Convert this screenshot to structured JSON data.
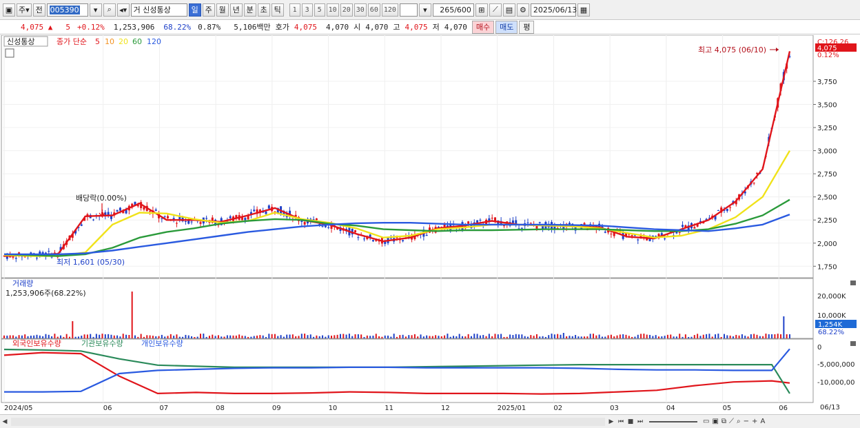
{
  "toolbar": {
    "market": "주",
    "prev_label": "전",
    "code": "005390",
    "type_prefix": "거",
    "stock_name": "신성통상",
    "periods": [
      "일",
      "주",
      "월",
      "년",
      "분",
      "초",
      "틱"
    ],
    "active_period": "일",
    "intervals": [
      "1",
      "3",
      "5",
      "10",
      "20",
      "30",
      "60",
      "120"
    ],
    "count": "265",
    "count_max": "/600",
    "date": "2025/06/13"
  },
  "quote": {
    "price": "4,075",
    "arrow": "▲",
    "change": "5",
    "change_pct": "+0.12%",
    "volume": "1,253,906",
    "volume_ratio": "68.22%",
    "turnover_pct": "0.87%",
    "amount": "5,106백만",
    "ask_label": "호가",
    "ask": "4,075",
    "bid": "4,070",
    "open_label": "시",
    "open": "4,070",
    "high_label": "고",
    "high": "4,075",
    "low_label": "저",
    "low": "4,070",
    "buy_label": "매수",
    "sell_label": "매도",
    "avg_label": "평"
  },
  "price_panel": {
    "tag": "신성통상",
    "legend_title": "종가 단순",
    "ma_labels": [
      "5",
      "10",
      "20",
      "60",
      "120"
    ],
    "ma_colors": [
      "#e0151b",
      "#f29222",
      "#f0e21a",
      "#2a9a3a",
      "#2a5ae0"
    ],
    "y_ticks": [
      "3,750",
      "3,500",
      "3,250",
      "3,000",
      "2,750",
      "2,500",
      "2,250",
      "2,000",
      "1,750"
    ],
    "y_top_label": "C:126.26",
    "current_tag": "4,075",
    "current_pct": "0.12%",
    "high_annotation": "최고 4,075 (06/10)",
    "low_annotation": "최저 1,601 (05/30)",
    "dividend_annotation": "배당락(0.00%)"
  },
  "volume_panel": {
    "title": "거래량",
    "value": "1,253,906주(68.22%)",
    "y_ticks": [
      "20,000K",
      "10,000K"
    ],
    "current_tag": "1,254K",
    "current_pct": "68.22%"
  },
  "holding_panel": {
    "legend": [
      {
        "label": "외국인보유수량",
        "color": "#e0151b"
      },
      {
        "label": "기관보유수량",
        "color": "#2a8a5a"
      },
      {
        "label": "개인보유수량",
        "color": "#2a5ae0"
      }
    ],
    "y_ticks": [
      "0",
      "-5,000,000",
      "-10,000,00"
    ]
  },
  "x_axis": {
    "labels": [
      "2024/05",
      "06",
      "07",
      "08",
      "09",
      "10",
      "11",
      "12",
      "2025/01",
      "02",
      "03",
      "04",
      "05",
      "06"
    ],
    "right_label": "06/13"
  },
  "chart_data": {
    "type": "line",
    "series": [
      {
        "name": "5",
        "color": "#e0151b",
        "values": [
          1860,
          1870,
          1885,
          2290,
          2300,
          2430,
          2250,
          2250,
          2230,
          2300,
          2380,
          2250,
          2200,
          2100,
          2020,
          2060,
          2160,
          2190,
          2240,
          2200,
          2190,
          2180,
          2170,
          2070,
          2050,
          2150,
          2250,
          2450,
          2800,
          4075
        ]
      },
      {
        "name": "20",
        "color": "#f0e21a",
        "values": [
          1870,
          1860,
          1860,
          1900,
          2200,
          2330,
          2320,
          2260,
          2220,
          2240,
          2330,
          2260,
          2220,
          2160,
          2060,
          2080,
          2150,
          2170,
          2200,
          2200,
          2190,
          2180,
          2160,
          2110,
          2060,
          2080,
          2150,
          2280,
          2500,
          3000
        ]
      },
      {
        "name": "60",
        "color": "#2a9a3a",
        "values": [
          1880,
          1870,
          1860,
          1880,
          1950,
          2060,
          2120,
          2160,
          2210,
          2240,
          2260,
          2250,
          2210,
          2190,
          2150,
          2140,
          2130,
          2140,
          2140,
          2145,
          2150,
          2150,
          2150,
          2140,
          2130,
          2130,
          2150,
          2210,
          2300,
          2470
        ]
      },
      {
        "name": "120",
        "color": "#2a5ae0",
        "values": [
          1880,
          1880,
          1880,
          1890,
          1920,
          1960,
          2000,
          2040,
          2080,
          2120,
          2150,
          2180,
          2200,
          2215,
          2220,
          2220,
          2210,
          2200,
          2200,
          2200,
          2200,
          2195,
          2190,
          2170,
          2150,
          2140,
          2130,
          2160,
          2200,
          2310
        ]
      }
    ],
    "x_labels": [
      "2024/05",
      "06",
      "07",
      "08",
      "09",
      "10",
      "11",
      "12",
      "2025/01",
      "02",
      "03",
      "04",
      "05",
      "06"
    ],
    "ylim": [
      1700,
      4100
    ]
  }
}
